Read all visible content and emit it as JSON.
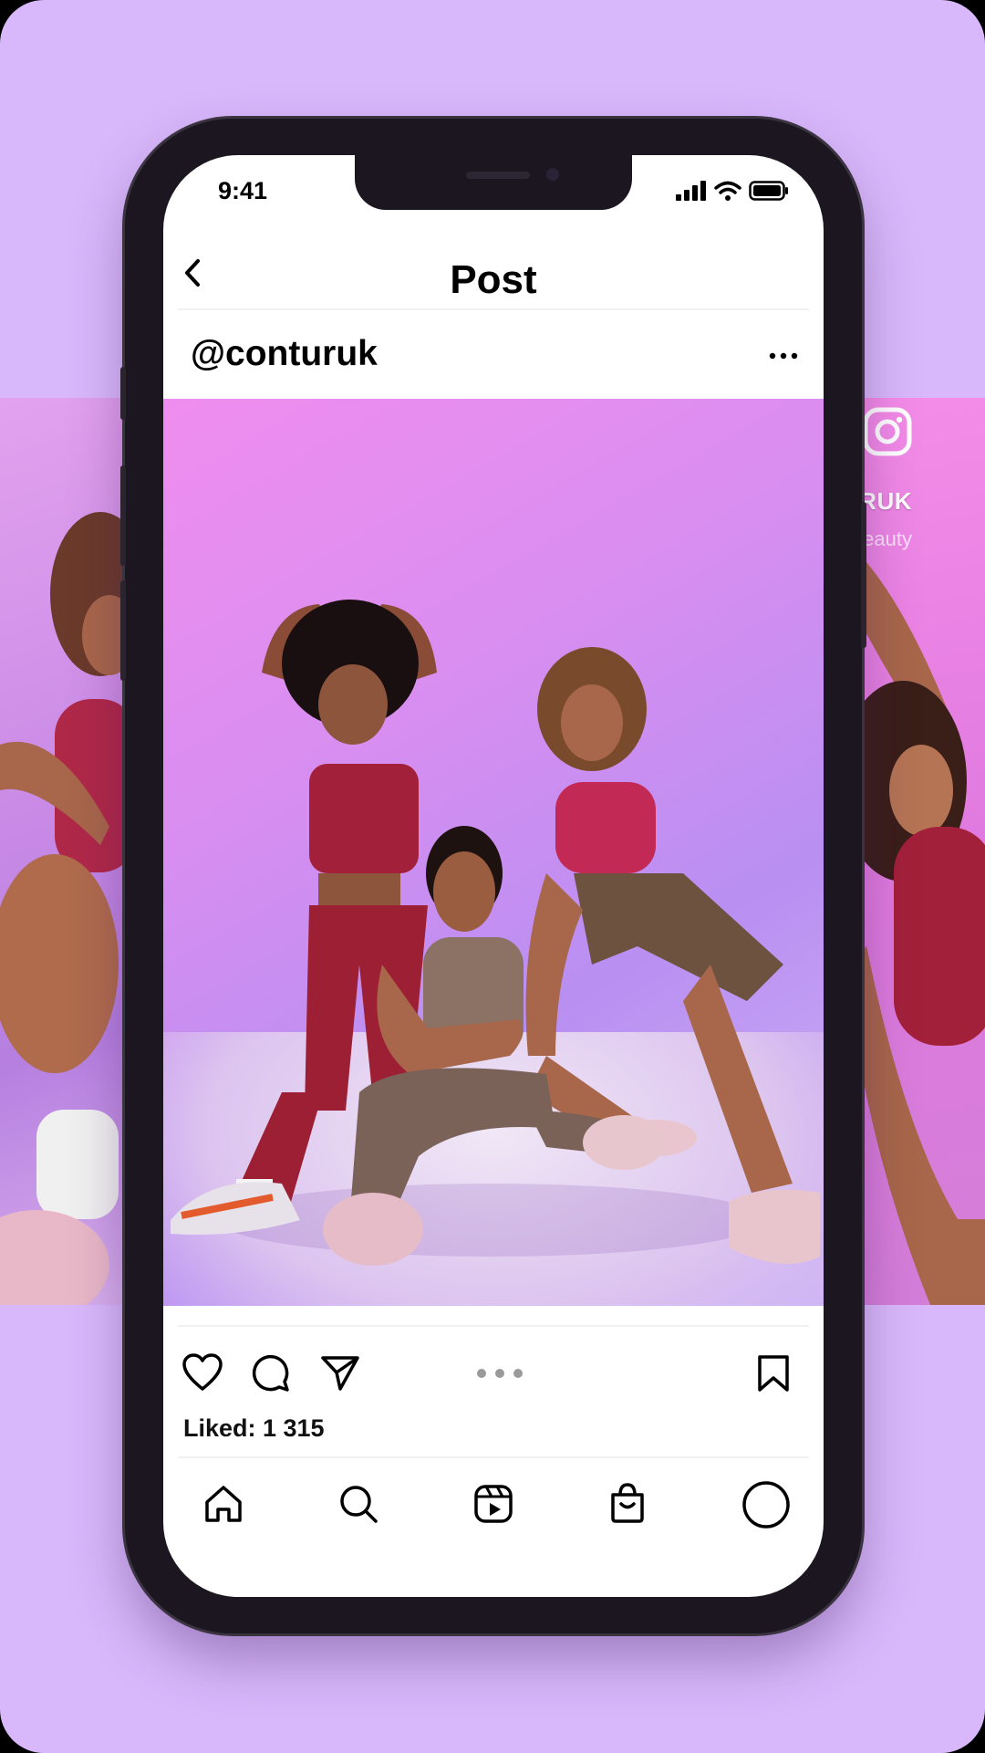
{
  "status_bar": {
    "time": "9:41"
  },
  "header": {
    "title": "Post"
  },
  "post": {
    "username": "@conturuk",
    "likes_text": "Liked: 1 315"
  },
  "overlay": {
    "handle": "@CONTURUK",
    "track": "ger Twins · Thing of Beauty"
  },
  "icons": {
    "back": "chevron-left-icon",
    "more": "more-horizontal-icon",
    "like": "heart-icon",
    "comment": "comment-icon",
    "share": "send-icon",
    "carousel": "carousel-dots",
    "save": "bookmark-icon",
    "home": "home-icon",
    "search": "search-icon",
    "reels": "reels-icon",
    "shop": "shop-icon",
    "profile": "profile-icon",
    "instagram": "instagram-icon"
  },
  "colors": {
    "background": "#d8b8fb",
    "photo_pink": "#f08df0",
    "photo_lilac": "#b98ff2",
    "outfit_red": "#a3203a"
  }
}
